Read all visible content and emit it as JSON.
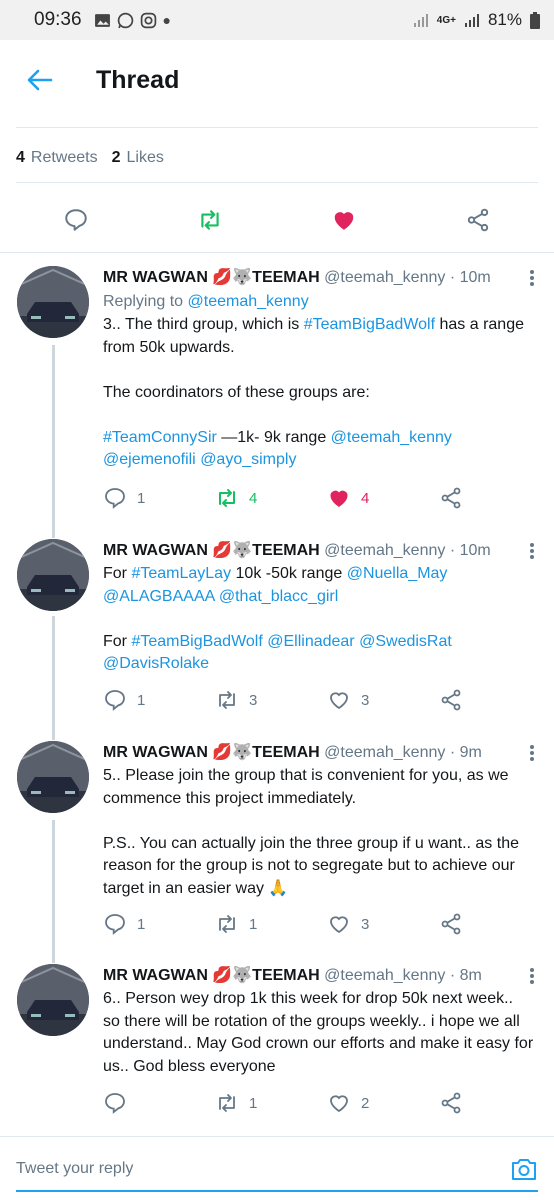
{
  "status_bar": {
    "time": "09:36",
    "network": "4G+",
    "battery": "81%"
  },
  "header": {
    "title": "Thread"
  },
  "stats": {
    "retweets_count": "4",
    "retweets_label": "Retweets",
    "likes_count": "2",
    "likes_label": "Likes"
  },
  "tweets": [
    {
      "name": "MR WAGWAN 💋🐺TEEMAH",
      "handle": "@teemah_kenny",
      "time": "· 10m",
      "replying_label": "Replying to",
      "replying_handle": "@teemah_kenny",
      "l1a": "3.. The third group, which is ",
      "l1b": "#TeamBigBadWolf",
      "l1c": " has a range from 50k upwards.",
      "l2": "The coordinators of these groups are:",
      "l3a": "#TeamConnySir",
      "l3b": " —1k- 9k range ",
      "l3c": "@teemah_kenny",
      "l3d": "@ejemenofili",
      "l3e": "@ayo_simply",
      "replies": "1",
      "retweets": "4",
      "likes": "4"
    },
    {
      "name": "MR WAGWAN 💋🐺TEEMAH",
      "handle": "@teemah_kenny",
      "time": "· 10m",
      "l1a": "For ",
      "l1b": "#TeamLayLay",
      "l1c": " 10k -50k range ",
      "l1d": "@Nuella_May",
      "l1e": "@ALAGBAAAA",
      "l1f": "@that_blacc_girl",
      "l2a": "For ",
      "l2b": "#TeamBigBadWolf",
      "l2c": "@Ellinadear",
      "l2d": "@SwedisRat",
      "l2e": "@DavisRolake",
      "replies": "1",
      "retweets": "3",
      "likes": "3"
    },
    {
      "name": "MR WAGWAN 💋🐺TEEMAH",
      "handle": "@teemah_kenny",
      "time": "· 9m",
      "p1": "5.. Please join the group that is convenient for you, as we commence this project immediately.",
      "p2": "P.S.. You can actually join the three group if u want.. as the reason for the group is not to segregate but to achieve our target in an easier way 🙏",
      "replies": "1",
      "retweets": "1",
      "likes": "3"
    },
    {
      "name": "MR WAGWAN 💋🐺TEEMAH",
      "handle": "@teemah_kenny",
      "time": "· 8m",
      "p1": "6.. Person wey drop 1k this week for drop 50k next week.. so there will be rotation of the groups weekly.. i hope we all understand.. May God crown our efforts and make it easy for us.. God bless everyone",
      "replies": "",
      "retweets": "1",
      "likes": "2"
    }
  ],
  "composer": {
    "placeholder": "Tweet your reply"
  },
  "colors": {
    "accent": "#1da1f2",
    "link": "#1b95e0",
    "retweet_active": "#17bf63",
    "like_active": "#e0245e",
    "muted": "#657786"
  }
}
